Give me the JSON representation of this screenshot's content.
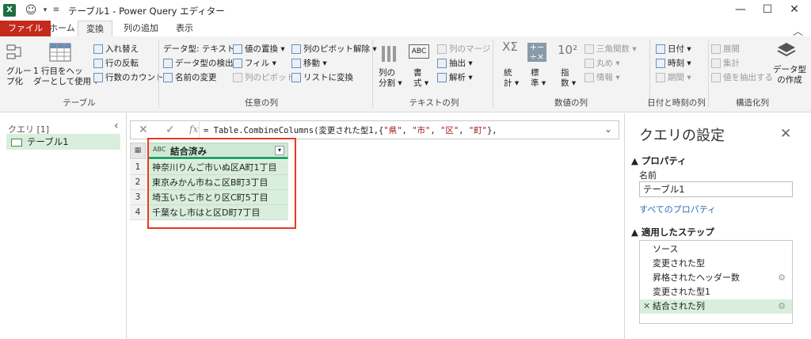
{
  "window": {
    "title": "テーブル1 - Power Query エディター",
    "app_icon": "X"
  },
  "tabs": [
    "ファイル",
    "ホーム",
    "変換",
    "列の追加",
    "表示"
  ],
  "ribbon": {
    "table_group": {
      "group_label": "テーブル",
      "group_by": "グルー\nプ化",
      "first_row": "1 行目をヘッ\nダーとして使用 ▾",
      "transpose": "入れ替え",
      "reverse": "行の反転",
      "count_rows": "行数のカウント"
    },
    "any_col_group": {
      "group_label": "任意の列",
      "data_type": "データ型: テキスト ▾",
      "detect_type": "データ型の検出",
      "rename": "名前の変更",
      "replace": "値の置換 ▾",
      "fill": "フィル ▾",
      "pivot": "列のピボット",
      "unpivot": "列のピボット解除 ▾",
      "move": "移動 ▾",
      "to_list": "リストに変換"
    },
    "text_col_group": {
      "group_label": "テキストの列",
      "split": "列の\n分割 ▾",
      "format": "書\n式 ▾",
      "merge": "列のマージ",
      "extract": "抽出 ▾",
      "parse": "解析 ▾"
    },
    "num_col_group": {
      "group_label": "数値の列",
      "stats": "統\n計 ▾",
      "standard": "標\n準 ▾",
      "sci": "指\n数 ▾",
      "trig": "三角関数 ▾",
      "round": "丸め ▾",
      "info": "情報 ▾"
    },
    "datetime_group": {
      "group_label": "日付と時刻の列",
      "date": "日付 ▾",
      "time": "時刻 ▾",
      "duration": "期間 ▾"
    },
    "struct_group": {
      "group_label": "構造化列",
      "expand": "展開",
      "aggregate": "集計",
      "extract_values": "値を抽出する",
      "data_type_create": "データ型\nの作成"
    }
  },
  "queries_pane": {
    "header": "クエリ [1]",
    "items": [
      "テーブル1"
    ]
  },
  "formula_bar": {
    "prefix": "= Table.CombineColumns(変更された型1,{",
    "s1": "\"県\"",
    "c1": ", ",
    "s2": "\"市\"",
    "c2": ", ",
    "s3": "\"区\"",
    "c3": ", ",
    "s4": "\"町\"",
    "suffix": "},",
    "cancel": "✕",
    "commit": "✓",
    "fx": "fx"
  },
  "grid": {
    "column_header": "結合済み",
    "type_icon": "ABC",
    "rows": [
      {
        "n": "1",
        "v": "神奈川りんご市いぬ区A町1丁目"
      },
      {
        "n": "2",
        "v": "東京みかん市ねこ区B町3丁目"
      },
      {
        "n": "3",
        "v": "埼玉いちご市とり区C町5丁目"
      },
      {
        "n": "4",
        "v": "千葉なし市はと区D町7丁目"
      }
    ]
  },
  "settings": {
    "title": "クエリの設定",
    "properties_header": "▲ プロパティ",
    "name_label": "名前",
    "name_value": "テーブル1",
    "all_props_link": "すべてのプロパティ",
    "steps_header": "▲ 適用したステップ",
    "steps": [
      "ソース",
      "変更された型",
      "昇格されたヘッダー数",
      "変更された型1",
      "結合された列"
    ]
  },
  "colors": {
    "accent_green": "#21a366",
    "file_tab": "#c42b1c",
    "highlight_box": "#e8391e"
  }
}
